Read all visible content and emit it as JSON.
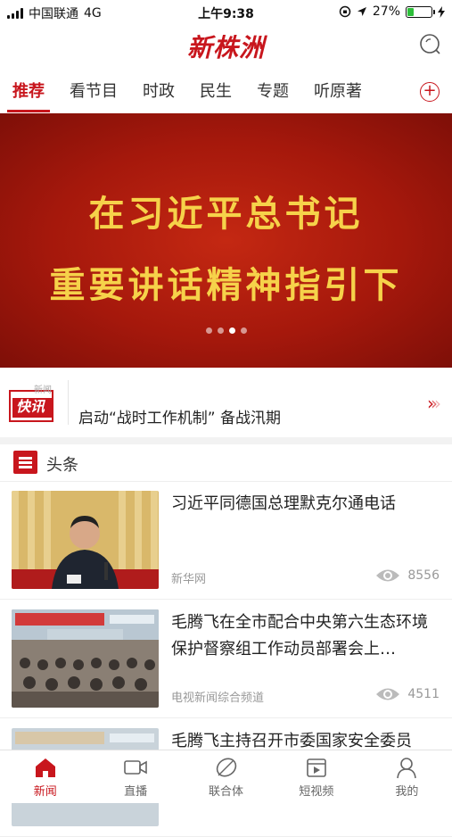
{
  "status_bar": {
    "carrier": "中国联通",
    "network": "4G",
    "time": "上午9:38",
    "battery": "27%",
    "battery_level": 0.27
  },
  "header": {
    "logo": "新株洲"
  },
  "tabs": [
    {
      "label": "推荐",
      "active": true
    },
    {
      "label": "看节目"
    },
    {
      "label": "时政"
    },
    {
      "label": "民生"
    },
    {
      "label": "专题"
    },
    {
      "label": "听原著"
    }
  ],
  "banner": {
    "line1": "在习近平总书记",
    "line2": "重要讲话精神指引下",
    "active_slide": 2,
    "slide_count": 4
  },
  "flash": {
    "badge_top": "新闻",
    "badge_main": "快讯",
    "text": "启动“战时工作机制” 备战汛期"
  },
  "section": {
    "title": "头条"
  },
  "news": [
    {
      "title": "习近平同德国总理默克尔通电话",
      "source": "新华网",
      "views": "8556"
    },
    {
      "title": "毛腾飞在全市配合中央第六生态环境保护督察组工作动员部署会上…",
      "source": "电视新闻综合频道",
      "views": "4511"
    },
    {
      "title": "毛腾飞主持召开市委国家安全委员",
      "source": "",
      "views": ""
    }
  ],
  "bottom_nav": [
    {
      "label": "新闻",
      "icon": "home-icon",
      "active": true
    },
    {
      "label": "直播",
      "icon": "video-camera-icon"
    },
    {
      "label": "联合体",
      "icon": "leaf-icon"
    },
    {
      "label": "短视频",
      "icon": "film-icon"
    },
    {
      "label": "我的",
      "icon": "user-icon"
    }
  ],
  "colors": {
    "accent": "#c8161d",
    "banner_text": "#f6d24a"
  }
}
